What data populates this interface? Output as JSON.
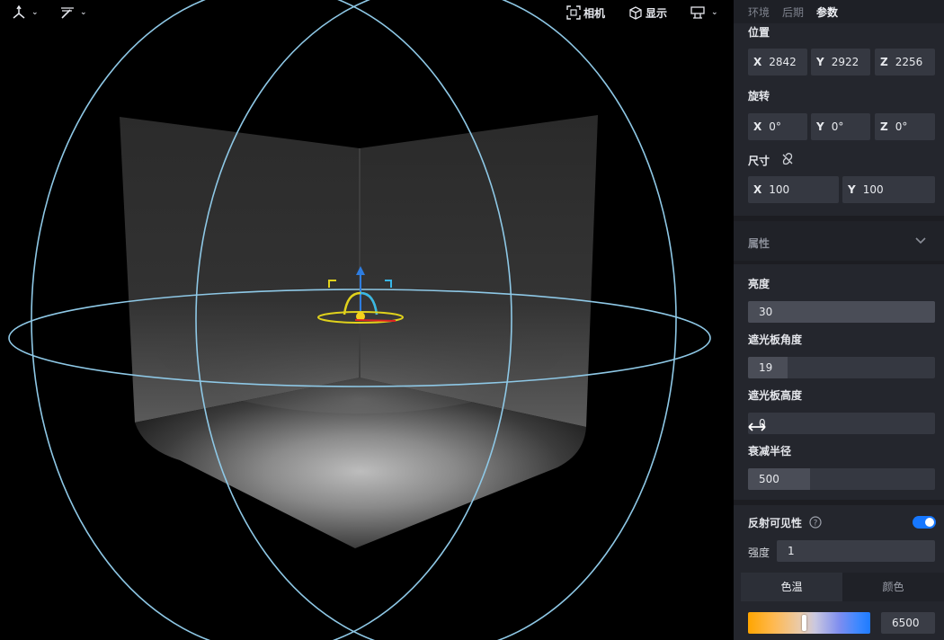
{
  "viewport": {
    "toolbar": {
      "transform_icon": "axes-icon",
      "brush_icon": "magic-wand-icon",
      "camera_label": "相机",
      "display_label": "显示",
      "layout_icon": "layout-icon"
    }
  },
  "panel": {
    "tabs": [
      "环境",
      "后期",
      "参数"
    ],
    "active_tab": "参数",
    "position": {
      "label": "位置",
      "x_axis": "X",
      "x": "2842",
      "y_axis": "Y",
      "y": "2922",
      "z_axis": "Z",
      "z": "2256"
    },
    "rotation": {
      "label": "旋转",
      "x_axis": "X",
      "x": "0°",
      "y_axis": "Y",
      "y": "0°",
      "z_axis": "Z",
      "z": "0°"
    },
    "size": {
      "label": "尺寸",
      "x_axis": "X",
      "x": "100",
      "y_axis": "Y",
      "y": "100"
    },
    "attributes": {
      "title": "属性",
      "brightness": {
        "label": "亮度",
        "value": "30",
        "fraction": 1.0
      },
      "shade_angle": {
        "label": "遮光板角度",
        "value": "19",
        "fraction": 0.21
      },
      "shade_height": {
        "label": "遮光板高度",
        "value": "0",
        "fraction": 0.0
      },
      "falloff_radius": {
        "label": "衰减半径",
        "value": "500",
        "fraction": 0.33
      }
    },
    "reflection": {
      "label": "反射可见性",
      "enabled": true,
      "intensity_label": "强度",
      "intensity": "1"
    },
    "color_tabs": [
      "色温",
      "颜色"
    ],
    "active_color_tab": "色温",
    "color_temperature": "6500",
    "color_temperature_fraction": 0.46
  }
}
